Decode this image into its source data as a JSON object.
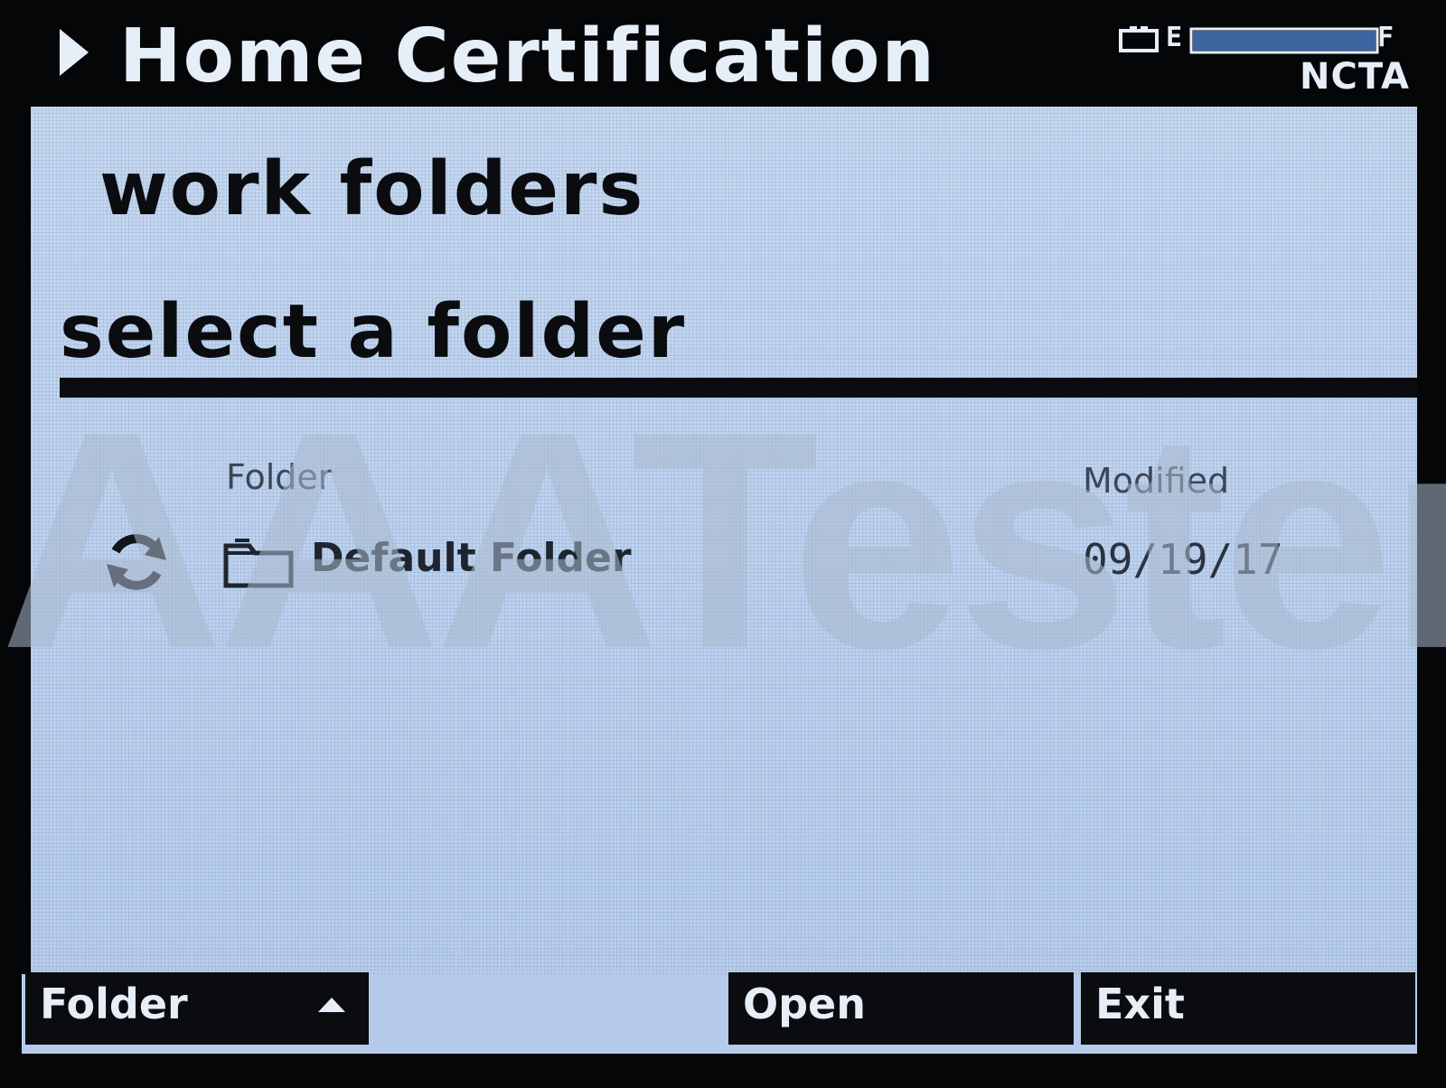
{
  "header": {
    "title": "Home Certification",
    "battery_empty_label": "E",
    "battery_full_label": "F",
    "battery_level": 1.0,
    "standard": "NCTA"
  },
  "panel": {
    "title": "work folders",
    "prompt": "select a folder"
  },
  "table": {
    "columns": [
      "Folder",
      "Modified"
    ],
    "rows": [
      {
        "name": "Default Folder",
        "modified": "09/19/17"
      }
    ]
  },
  "watermark": "AAATesters",
  "softkeys": {
    "folder": "Folder",
    "open": "Open",
    "exit": "Exit"
  },
  "colors": {
    "background": "#050608",
    "panel": "#bdd2ee",
    "text_dark": "#0a0c10",
    "text_light": "#e6eef8"
  },
  "icons": [
    "play-icon",
    "battery-icon",
    "sync-icon",
    "folder-icon",
    "up-arrow-icon"
  ]
}
